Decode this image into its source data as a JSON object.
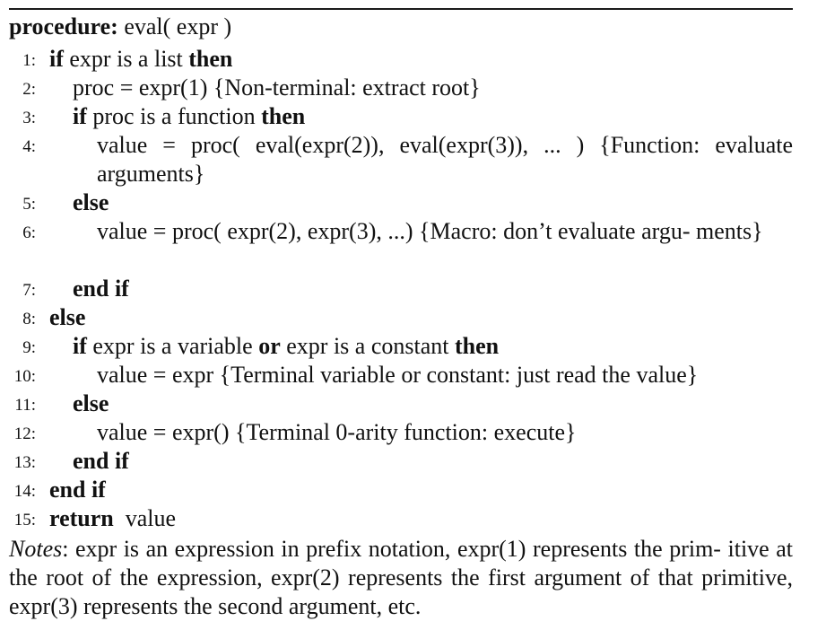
{
  "header": {
    "keyword": "procedure:",
    "signature": "eval( expr )"
  },
  "lines": [
    {
      "no": "1:",
      "parts": [
        {
          "t": "if",
          "b": true
        },
        {
          "t": " expr is a list "
        },
        {
          "t": "then",
          "b": true
        }
      ]
    },
    {
      "no": "2:",
      "parts": [
        {
          "t": "proc = expr(1) {Non-terminal: extract root}"
        }
      ]
    },
    {
      "no": "3:",
      "parts": [
        {
          "t": "if",
          "b": true
        },
        {
          "t": " proc is a function "
        },
        {
          "t": "then",
          "b": true
        }
      ]
    },
    {
      "no": "4:",
      "parts": [
        {
          "t": "value = proc( eval(expr(2)), eval(expr(3)), ... ) {Function: evaluate arguments}"
        }
      ]
    },
    {
      "no": "5:",
      "parts": [
        {
          "t": "else",
          "b": true
        }
      ]
    },
    {
      "no": "6:",
      "parts": [
        {
          "t": "value = proc( expr(2), expr(3), ...) {Macro: don’t evaluate argu- ments}"
        }
      ]
    },
    {
      "no": "7:",
      "parts": [
        {
          "t": "end if",
          "b": true
        }
      ]
    },
    {
      "no": "8:",
      "parts": [
        {
          "t": "else",
          "b": true
        }
      ]
    },
    {
      "no": "9:",
      "parts": [
        {
          "t": "if",
          "b": true
        },
        {
          "t": " expr is a variable "
        },
        {
          "t": "or",
          "b": true
        },
        {
          "t": " expr is a constant "
        },
        {
          "t": "then",
          "b": true
        }
      ]
    },
    {
      "no": "10:",
      "parts": [
        {
          "t": "value = expr {Terminal variable or constant: just read the value}"
        }
      ]
    },
    {
      "no": "11:",
      "parts": [
        {
          "t": "else",
          "b": true
        }
      ]
    },
    {
      "no": "12:",
      "parts": [
        {
          "t": "value = expr() {Terminal 0-arity function: execute}"
        }
      ]
    },
    {
      "no": "13:",
      "parts": [
        {
          "t": "end if",
          "b": true
        }
      ]
    },
    {
      "no": "14:",
      "parts": [
        {
          "t": "end if",
          "b": true
        }
      ]
    },
    {
      "no": "15:",
      "parts": [
        {
          "t": "return",
          "b": true
        },
        {
          "t": "  value"
        }
      ]
    }
  ],
  "notes": {
    "label": "Notes",
    "text": ": expr is an expression in prefix notation, expr(1) represents the prim- itive at the root of the expression, expr(2) represents the first argument of that primitive, expr(3) represents the second argument, etc."
  }
}
